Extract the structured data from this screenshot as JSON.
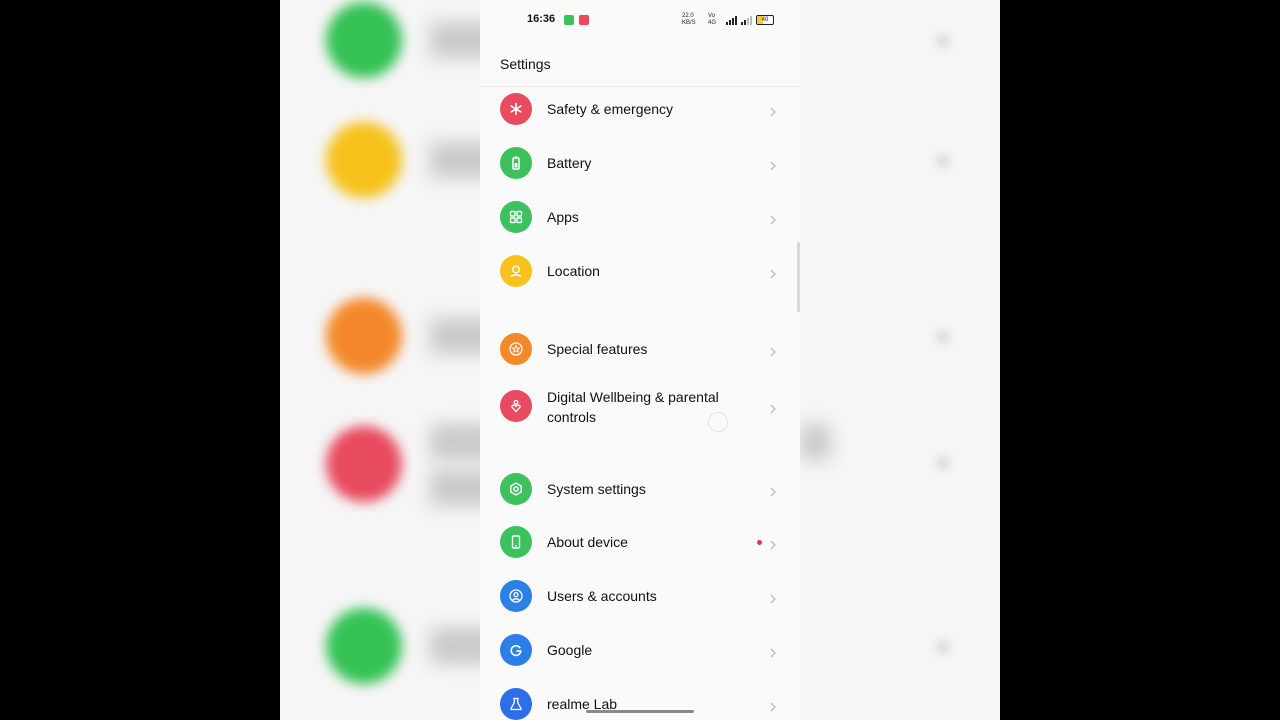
{
  "status_bar": {
    "time": "16:36",
    "network_speed": "22.0 KB/S",
    "network_type": "Vo 4G",
    "battery": "40"
  },
  "header": {
    "title": "Settings"
  },
  "settings_items": [
    {
      "label": "Safety & emergency",
      "icon": "asterisk-icon",
      "color": "#e84a5f"
    },
    {
      "label": "Battery",
      "icon": "battery-icon",
      "color": "#3cc15d"
    },
    {
      "label": "Apps",
      "icon": "grid-icon",
      "color": "#3cc15d"
    },
    {
      "label": "Location",
      "icon": "location-pin-icon",
      "color": "#f6c21b"
    },
    {
      "label": "Special features",
      "icon": "star-circle-icon",
      "color": "#f4882a"
    },
    {
      "label": "Digital Wellbeing & parental controls",
      "icon": "heart-person-icon",
      "color": "#e84a5f"
    },
    {
      "label": "System settings",
      "icon": "gear-icon",
      "color": "#3cc15d"
    },
    {
      "label": "About device",
      "icon": "phone-icon",
      "color": "#3cc15d"
    },
    {
      "label": "Users & accounts",
      "icon": "user-circle-icon",
      "color": "#2d7fe8"
    },
    {
      "label": "Google",
      "icon": "google-g-icon",
      "color": "#2d7fe8"
    },
    {
      "label": "realme Lab",
      "icon": "flask-icon",
      "color": "#2d6fe8"
    }
  ]
}
